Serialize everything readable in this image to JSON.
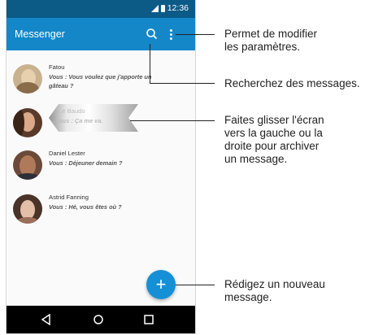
{
  "status_bar": {
    "time": "12:36"
  },
  "app_bar": {
    "title": "Messenger"
  },
  "conversations": [
    {
      "name": "Fatou",
      "preview": "Vous : Vous voulez que j'apporte un gâteau ?"
    },
    {
      "name": "...e Baudo",
      "preview": "...ous : Ça me va."
    },
    {
      "name": "Daniel Lester",
      "preview": "Vous : Déjeuner demain ?"
    },
    {
      "name": "Astrid Fanning",
      "preview": "Vous : Hé, vous êtes où ?"
    }
  ],
  "fab": {
    "symbol": "+"
  },
  "nav": {
    "back": "back-icon",
    "home": "home-icon",
    "recents": "recents-icon"
  },
  "callouts": {
    "settings_line1": "Permet de modifier",
    "settings_line2": "les paramètres.",
    "search": "Recherchez des messages.",
    "swipe_line1": "Faites glisser l'écran",
    "swipe_line2": "vers la gauche ou la",
    "swipe_line3": "droite pour archiver",
    "swipe_line4": "un message.",
    "compose_line1": "Rédigez un nouveau",
    "compose_line2": "message."
  },
  "colors": {
    "status_bar": "#0c5a86",
    "app_bar": "#1487c9",
    "fab": "#1590d6"
  }
}
